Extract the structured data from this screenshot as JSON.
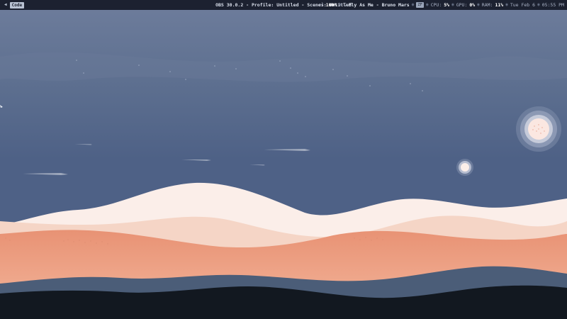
{
  "topbar": {
    "menu_icon": "arrow-left-icon",
    "workspace": "Code",
    "window_title": "OBS 30.0.2 - Profile: Untitled - Scenes: Untitled",
    "volume_icon": "speaker-icon",
    "volume": "100%",
    "music_icon": "music-note-icon",
    "now_playing": "Fly As Me - Bruno Mars",
    "tray_badge": "ZF",
    "cpu_label": "CPU:",
    "cpu_value": "5%",
    "gpu_label": "GPU:",
    "gpu_value": "0%",
    "ram_label": "RAM:",
    "ram_value": "11%",
    "date": "Tue Feb 6",
    "time": "05:55 PM"
  },
  "wallpaper": {
    "colors": {
      "sky": "#4e6186",
      "sky_top": "#6b7b9a",
      "dunes_light": "#fbeee9",
      "dunes_pink": "#f5d5c6",
      "dunes_orange": "#e9977a",
      "dunes_peach": "#f2b49a",
      "hills_slate": "#4b5d78",
      "hills_dark": "#121820",
      "sun": "#fbe7e1"
    }
  }
}
